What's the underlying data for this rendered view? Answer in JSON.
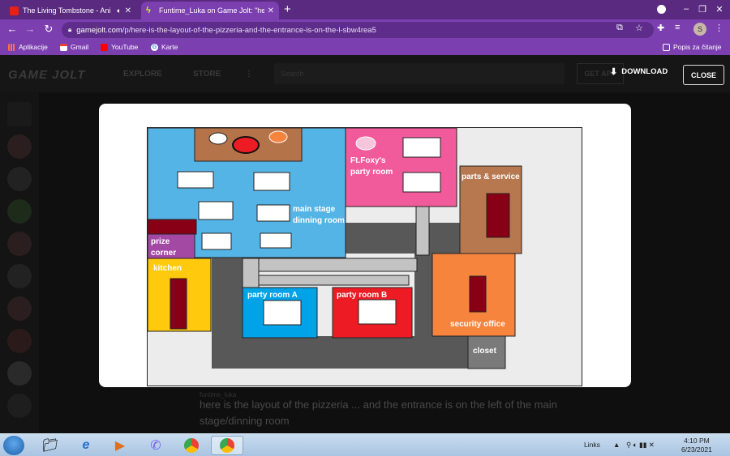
{
  "browser": {
    "tabs": [
      {
        "title": "The Living Tombstone - Ani",
        "favicon": "youtube-icon",
        "audio": true,
        "active": false
      },
      {
        "title": "Funtime_Luka on Game Jolt: \"he",
        "favicon": "gamejolt-icon",
        "active": true
      }
    ],
    "new_tab_label": "+",
    "url_host": "gamejolt.com",
    "url_path": "/p/here-is-the-layout-of-the-pizzeria-and-the-entrance-is-on-the-l-sbw4rea5",
    "profile_initial": "S",
    "bookmarks": [
      {
        "label": "Aplikacije",
        "icon": "apps-grid-icon"
      },
      {
        "label": "Gmail",
        "icon": "gmail-icon"
      },
      {
        "label": "YouTube",
        "icon": "youtube-icon"
      },
      {
        "label": "Karte",
        "icon": "google-icon"
      }
    ],
    "reading_list_label": "Popis za čitanje"
  },
  "site": {
    "logo": "GAME JOLT",
    "nav": [
      "EXPLORE",
      "STORE"
    ],
    "search_placeholder": "Search",
    "get_app": "GET APP",
    "download_label": "DOWNLOAD",
    "close_label": "CLOSE",
    "post_author": "funtime_luka",
    "post_text": "here is the layout of the pizzeria ... and the entrance is on the left of the main stage/dinning room"
  },
  "map": {
    "labels": {
      "main_stage": "main stage\ndinning room",
      "foxy": "Ft.Foxy's\nparty room",
      "parts": "parts & service",
      "prize": "prize\ncorner",
      "kitchen": "kitchen",
      "party_a": "party room A",
      "party_b": "party room B",
      "security": "security office",
      "closet": "closet"
    },
    "colors": {
      "dining": "#55b4e6",
      "stage": "#b5734a",
      "foxy": "#f15b9c",
      "parts": "#b8784f",
      "security": "#f7843d",
      "kitchen": "#ffc90e",
      "prize": "#a349a4",
      "party_a": "#00a2e8",
      "party_b": "#ed1c24",
      "dark_hall": "#585858",
      "light_hall": "#c3c3c3",
      "door": "#880015"
    }
  },
  "taskbar": {
    "links_label": "Links",
    "time": "4:10 PM",
    "date": "6/23/2021"
  }
}
